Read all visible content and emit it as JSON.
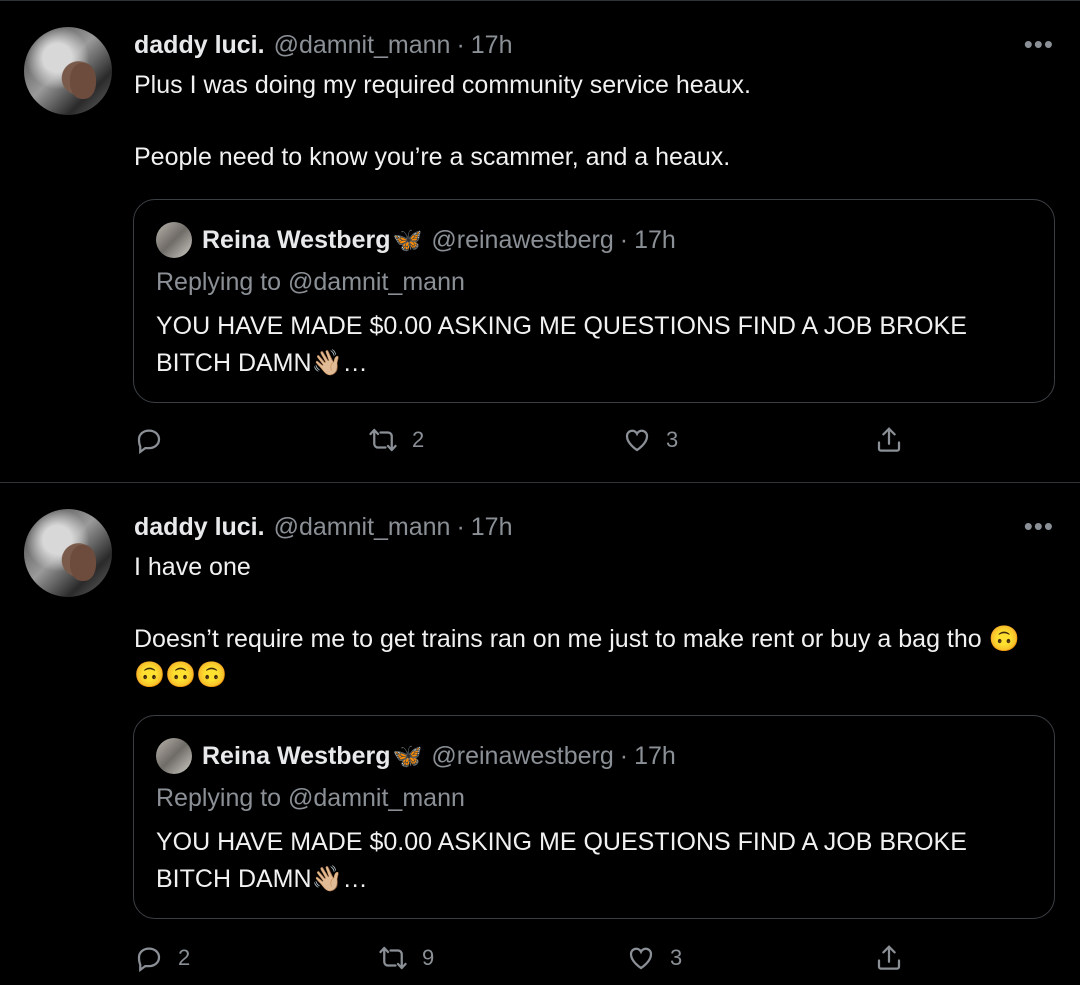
{
  "tweets": [
    {
      "author": {
        "name": "daddy luci.",
        "handle": "@damnit_mann",
        "sep": "·",
        "time": "17h"
      },
      "more": "•••",
      "body": [
        "Plus I was doing my required community service heaux.",
        "People need to know you’re a scammer, and a heaux."
      ],
      "quote": {
        "name": "Reina Westberg",
        "badge": "🦋",
        "handle": "@reinawestberg",
        "sep": "·",
        "time": "17h",
        "replying": "Replying to @damnit_mann",
        "text": "YOU HAVE MADE  $0.00 ASKING ME QUESTIONS FIND A JOB BROKE BITCH DAMN👋🏼…"
      },
      "actions": {
        "replies": "",
        "retweets": "2",
        "likes": "3"
      }
    },
    {
      "author": {
        "name": "daddy luci.",
        "handle": "@damnit_mann",
        "sep": "·",
        "time": "17h"
      },
      "more": "•••",
      "body": [
        "I have one",
        "Doesn’t require me to get trains ran on me just to make rent or buy a bag tho 🙃🙃🙃🙃"
      ],
      "quote": {
        "name": "Reina Westberg",
        "badge": "🦋",
        "handle": "@reinawestberg",
        "sep": "·",
        "time": "17h",
        "replying": "Replying to @damnit_mann",
        "text": "YOU HAVE MADE  $0.00 ASKING ME QUESTIONS FIND A JOB BROKE BITCH DAMN👋🏼…"
      },
      "actions": {
        "replies": "2",
        "retweets": "9",
        "likes": "3"
      }
    }
  ],
  "icons": [
    "reply-icon",
    "retweet-icon",
    "like-icon",
    "share-icon",
    "more-icon"
  ],
  "colors": {
    "background": "#000000",
    "text": "#e7e9ea",
    "secondary": "#8b9096",
    "border": "#2f3336",
    "badge": "#5fa8e8"
  }
}
